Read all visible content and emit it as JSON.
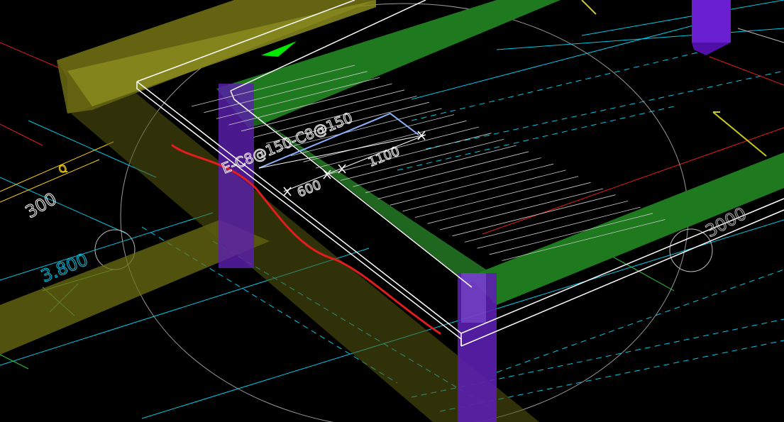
{
  "colors": {
    "background": "#000000",
    "beam_yellow": "#8a8a1e",
    "beam_green": "#1f7a1f",
    "column_purple": "#6a1fd0",
    "slab_outline": "#ffffff",
    "cyan_dash": "#00c8e6",
    "red_line": "#e11d1d",
    "rebar_blue": "#8fb3ff",
    "axis_gray": "#bbbbbb"
  },
  "dimensions": {
    "slab_strip_width": "600",
    "rebar_span": "1100",
    "left_axis_offset": "300",
    "right_beam_span": "3000"
  },
  "annotations": {
    "rebar_label": "E-C8@150-C8@150",
    "elevation_left": "3.800",
    "small_tag": "Q"
  },
  "icons": {
    "green_arrow": "direction-arrow-icon",
    "axis_bubble": "grid-axis-bubble-icon"
  }
}
